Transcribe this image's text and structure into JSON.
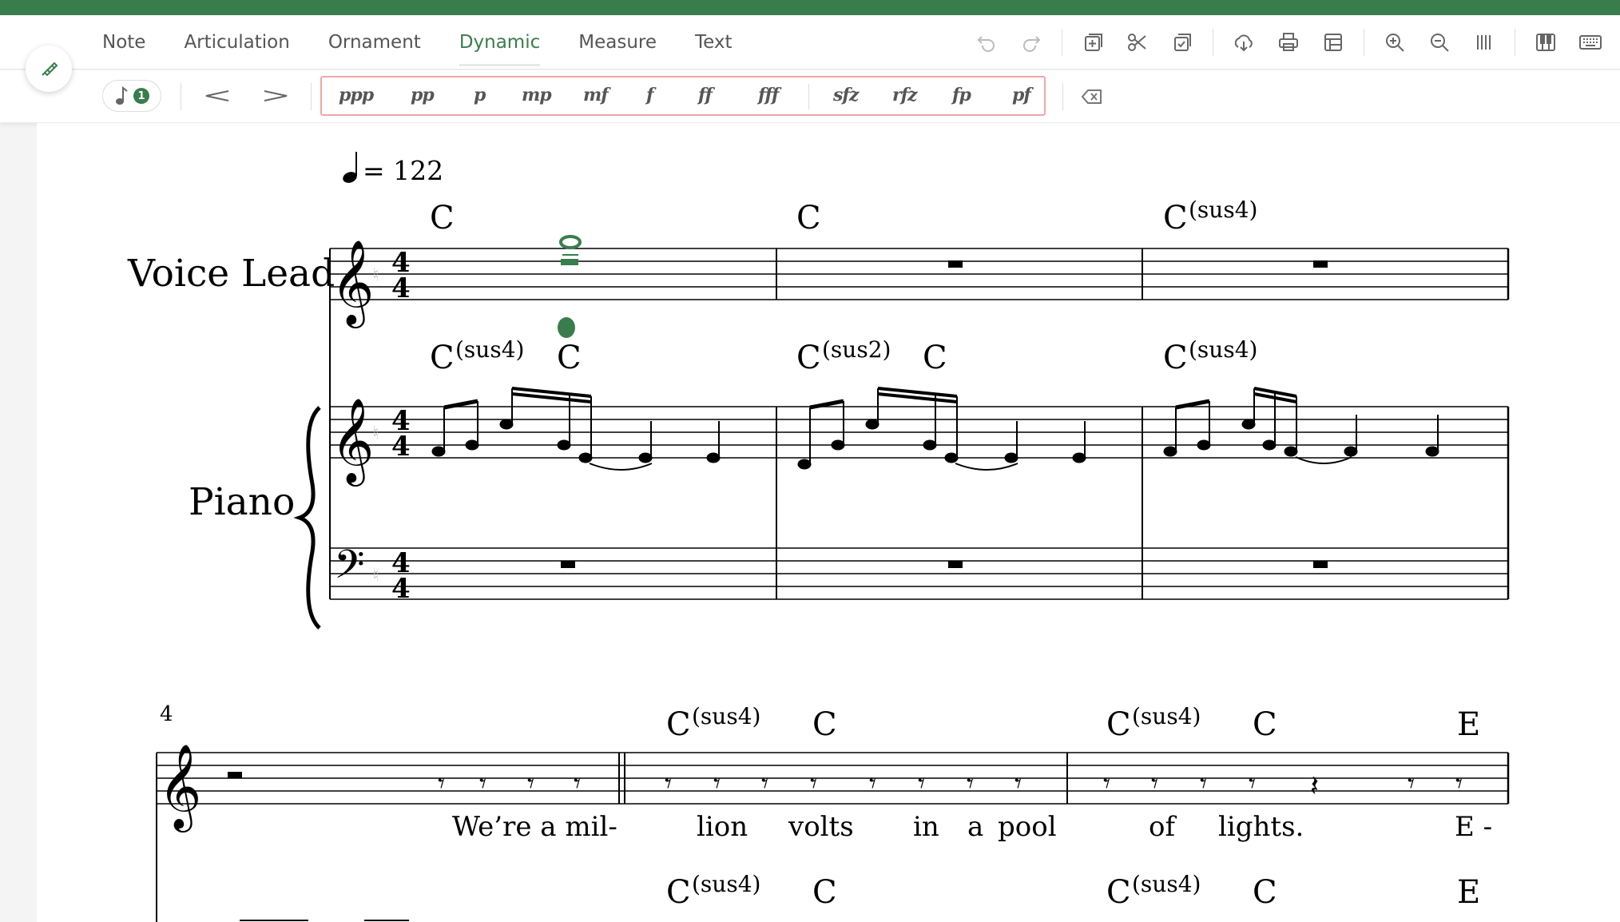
{
  "menu": {
    "tabs": [
      {
        "label": "Note"
      },
      {
        "label": "Articulation"
      },
      {
        "label": "Ornament"
      },
      {
        "label": "Dynamic",
        "active": true
      },
      {
        "label": "Measure"
      },
      {
        "label": "Text"
      }
    ],
    "accent_color": "#3a7d4c"
  },
  "toolbar_icons": [
    "undo-icon",
    "redo-icon",
    "add-measure-icon",
    "cut-icon",
    "paste-icon",
    "download-icon",
    "print-icon",
    "layout-icon",
    "zoom-in-icon",
    "zoom-out-icon",
    "bars-icon",
    "piano-icon",
    "keyboard-icon"
  ],
  "subbar": {
    "voice_badge": "1",
    "dynamics": [
      "ppp",
      "pp",
      "p",
      "mp",
      "mf",
      "f",
      "ff",
      "fff",
      "sfz",
      "rfz",
      "fp",
      "pf"
    ]
  },
  "score": {
    "tempo": "= 122",
    "instruments": [
      "Voice Lead",
      "Piano"
    ],
    "system1": {
      "voice_chords": [
        "C",
        "C",
        "C",
        "C"
      ],
      "voice_chord_sups": [
        "(sus4)"
      ],
      "piano_chords": [
        "C",
        "C",
        "C",
        "C",
        "C"
      ],
      "piano_chord_sups": [
        "(sus4)",
        "(sus2)",
        "(sus4)"
      ]
    },
    "system2": {
      "measure_number": "4",
      "chords": [
        "C",
        "C",
        "C",
        "C",
        "E"
      ],
      "chord_sups": [
        "(sus4)",
        "(sus4)"
      ],
      "lyrics": [
        "We’re a mil-",
        "lion",
        "volts",
        "in",
        "a",
        "pool",
        "of",
        "lights.",
        "E -"
      ],
      "piano_chords": [
        "C",
        "C",
        "C",
        "C",
        "E"
      ],
      "piano_chord_sups": [
        "(sus4)",
        "(sus4)"
      ]
    }
  }
}
